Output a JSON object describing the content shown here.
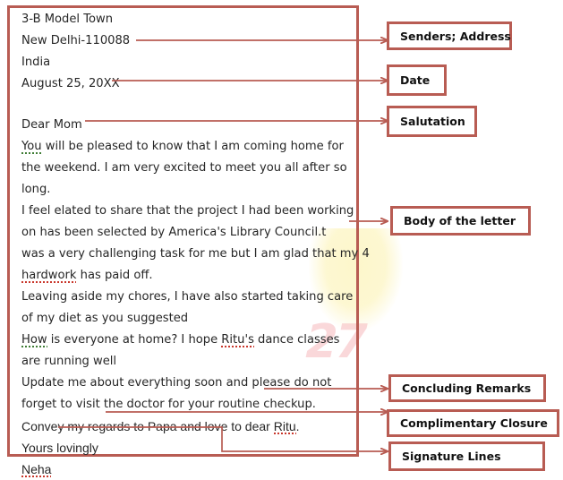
{
  "letter": {
    "lines": [
      {
        "id": "addr1",
        "text": "3-B Model Town",
        "style": "plain"
      },
      {
        "id": "addr2",
        "text": "New Delhi-110088",
        "style": "plain"
      },
      {
        "id": "addr3",
        "text": "India",
        "style": "plain"
      },
      {
        "id": "date",
        "text": "August 25, 20XX",
        "style": "plain"
      },
      {
        "id": "gap1",
        "text": "",
        "style": "blank"
      },
      {
        "id": "salutation",
        "text": "Dear Mom",
        "style": "plain"
      },
      {
        "id": "body1",
        "text": "You will be pleased to know that I am coming home for",
        "style": "grammar-first-word"
      },
      {
        "id": "body2",
        "text": "the weekend. I am very excited to meet you all after so",
        "style": "plain"
      },
      {
        "id": "body3",
        "text": "long.",
        "style": "plain"
      },
      {
        "id": "body4",
        "text": "I feel elated to share that the project I had been working",
        "style": "plain"
      },
      {
        "id": "body5",
        "text": "on has been selected by America's Library Council.t",
        "style": "plain"
      },
      {
        "id": "body6",
        "text": "was a very challenging task for me but I am glad that my 4",
        "style": "plain"
      },
      {
        "id": "body7",
        "text": "hardwork has paid off.",
        "style": "spell-first-word"
      },
      {
        "id": "body8",
        "text": "Leaving aside my chores, I have also started taking care",
        "style": "plain"
      },
      {
        "id": "body9",
        "text": "of my diet as you suggested",
        "style": "plain"
      },
      {
        "id": "body10",
        "text": "How is everyone at home? I hope Ritu's dance classes",
        "style": "grammar-first-word-and-ritus"
      },
      {
        "id": "body11",
        "text": "are running well",
        "style": "plain"
      },
      {
        "id": "body12",
        "text": "Update me about everything soon and please do not",
        "style": "plain"
      },
      {
        "id": "body13",
        "text": "forget to visit the doctor for your routine checkup.",
        "style": "plain"
      },
      {
        "id": "closing",
        "text": "Convey my regards to Papa  and love to dear Ritu.",
        "style": "sans2-spell-ritu"
      },
      {
        "id": "complimentary",
        "text": "Yours lovingly",
        "style": "sans2"
      },
      {
        "id": "signature",
        "text": "Neha",
        "style": "sans2-spell-word"
      }
    ],
    "segments": {
      "body1_mark": "You",
      "body1_rest": " will be pleased to know that I am coming home for",
      "body7_mark": "hardwork",
      "body7_rest": " has paid off.",
      "body10_mark": "How",
      "body10_mid": " is everyone at home? I hope ",
      "body10_mark2": "Ritu's",
      "body10_rest": " dance classes",
      "closing_pre": "Convey my regards to Papa  and love to dear ",
      "closing_mark": "Ritu",
      "closing_post": ".",
      "signature_mark": "Neha"
    }
  },
  "callouts": [
    {
      "id": "senders-address",
      "label": "Senders; Address"
    },
    {
      "id": "date",
      "label": "Date"
    },
    {
      "id": "salutation",
      "label": "Salutation"
    },
    {
      "id": "body-of-the-letter",
      "label": "Body of the letter"
    },
    {
      "id": "concluding-remarks",
      "label": "Concluding Remarks"
    },
    {
      "id": "complimentary-closure",
      "label": "Complimentary Closure"
    },
    {
      "id": "signature-lines",
      "label": "Signature Lines"
    }
  ],
  "watermark": {
    "text": "27"
  },
  "colors": {
    "accent": "#b85c53",
    "text": "#262626",
    "label_text": "#111111",
    "background": "#ffffff",
    "spell_error": "#c9372c",
    "grammar_error": "#3f7d35",
    "watermark_pink": "#f6b9bd",
    "watermark_yellow": "#fdf6c8"
  }
}
